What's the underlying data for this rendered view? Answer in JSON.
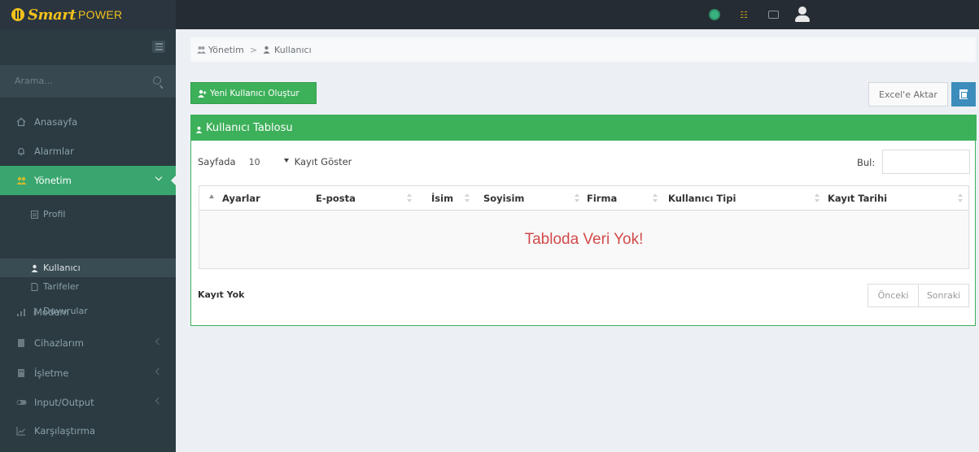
{
  "brand": {
    "smart": "Smart",
    "power": "POWER"
  },
  "topbar": {
    "icons": [
      "globe-icon",
      "rss-icon",
      "envelope-icon",
      "user-icon"
    ]
  },
  "sidebar": {
    "search_placeholder": "Arama...",
    "items": [
      {
        "label": "Anasayfa",
        "icon": "home-icon"
      },
      {
        "label": "Alarmlar",
        "icon": "bell-icon"
      },
      {
        "label": "Yönetim",
        "icon": "users-icon",
        "active": true
      },
      {
        "label": "Modem",
        "icon": "signal-icon"
      },
      {
        "label": "Cihazlarım",
        "icon": "device-icon"
      },
      {
        "label": "İşletme",
        "icon": "building-icon"
      },
      {
        "label": "Input/Output",
        "icon": "toggle-icon"
      },
      {
        "label": "Karşılaştırma",
        "icon": "chart-icon"
      }
    ],
    "subitems": [
      {
        "label": "Profil",
        "icon": "id-card-icon"
      },
      {
        "label": "Kullanıcı",
        "icon": "user-icon",
        "current": true
      },
      {
        "label": "Tarifeler",
        "icon": "file-icon"
      },
      {
        "label": "Duyurular",
        "icon": "info-icon"
      }
    ]
  },
  "breadcrumb": {
    "root": "Yönetim",
    "separator": ">",
    "current": "Kullanıcı"
  },
  "toolbar": {
    "new_user_label": "Yeni Kullanıcı Oluştur",
    "excel_label": "Excel'e Aktar"
  },
  "panel": {
    "title": "Kullanıcı Tablosu"
  },
  "table_controls": {
    "show_prefix": "Sayfada",
    "page_length": "10",
    "show_suffix": "Kayıt Göster",
    "search_label": "Bul:"
  },
  "table": {
    "columns": [
      "Ayarlar",
      "E-posta",
      "İsim",
      "Soyisim",
      "Firma",
      "Kullanıcı Tipi",
      "Kayıt Tarihi"
    ],
    "empty_message": "Tabloda Veri Yok!"
  },
  "footer": {
    "info": "Kayıt Yok",
    "prev_label": "Önceki",
    "next_label": "Sonraki"
  },
  "colors": {
    "accent_green": "#3db05a",
    "sidebar_bg": "#2c3b41",
    "topbar_bg": "#252c33",
    "brand_yellow": "#f2c11b",
    "empty_red": "#d24a4a",
    "excel_blue": "#3c8dbc"
  }
}
